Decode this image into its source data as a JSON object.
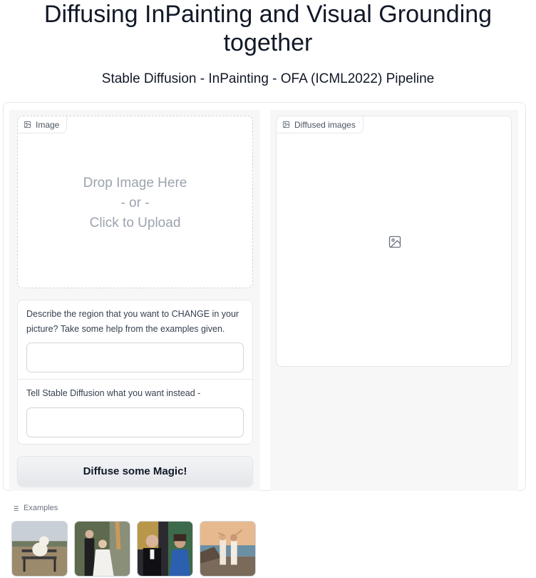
{
  "header": {
    "title": "Diffusing InPainting and Visual Grounding together",
    "subtitle": "Stable Diffusion - InPainting - OFA (ICML2022) Pipeline"
  },
  "image_input": {
    "label": "Image",
    "drop_line1": "Drop Image Here",
    "drop_line2": "- or -",
    "drop_line3": "Click to Upload"
  },
  "output": {
    "label": "Diffused images"
  },
  "text_inputs": {
    "change_label": "Describe the region that you want to CHANGE in your picture? Take some help from the examples given.",
    "change_value": "",
    "instead_label": "Tell Stable Diffusion what you want instead -",
    "instead_value": ""
  },
  "button": {
    "label": "Diffuse some Magic!"
  },
  "examples": {
    "label": "Examples",
    "items": [
      {
        "icon": "dog-on-bench-thumbnail"
      },
      {
        "icon": "couple-with-giraffe-thumbnail"
      },
      {
        "icon": "couple-at-golden-globes-thumbnail"
      },
      {
        "icon": "people-at-beach-thumbnail"
      }
    ]
  }
}
